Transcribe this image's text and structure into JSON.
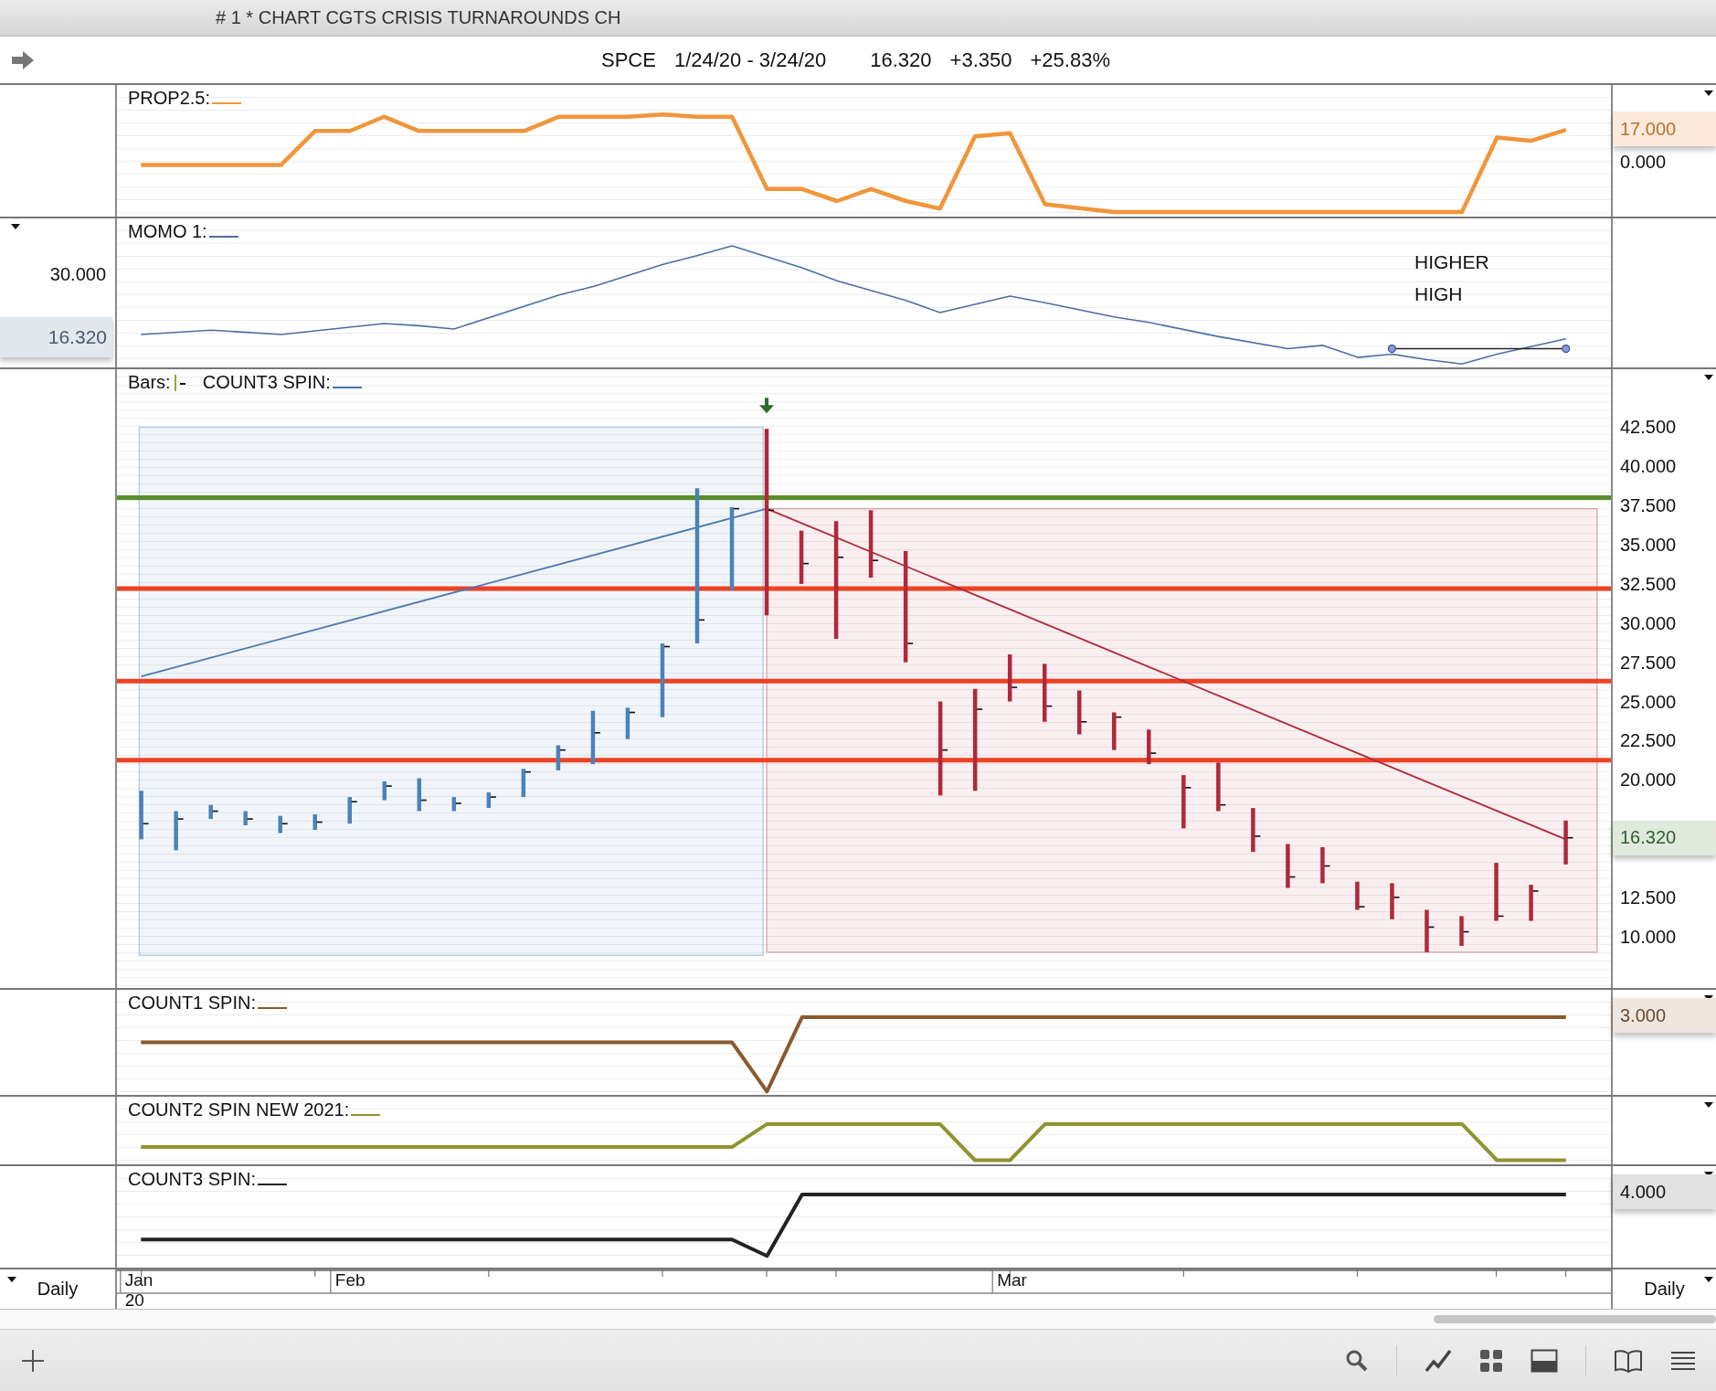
{
  "window": {
    "title": "# 1 * CHART CGTS CRISIS TURNAROUNDS CH"
  },
  "quote": {
    "symbol": "SPCE",
    "range": "1/24/20 - 3/24/20",
    "last": "16.320",
    "change": "+3.350",
    "percent": "+25.83%"
  },
  "panels": [
    {
      "kind": "prop",
      "title": "PROP2.5:",
      "color": "#f0963a",
      "badge": "17.000",
      "right_ticks": [
        "0.000"
      ]
    },
    {
      "kind": "momo",
      "title": "MOMO 1:",
      "color": "#4a6fa5",
      "left_ticks": [
        "30.000"
      ],
      "left_badge": "16.320",
      "note": "HIGHER HIGH"
    },
    {
      "kind": "price",
      "bars_label": "Bars:",
      "title": "COUNT3 SPIN:",
      "color": "#4a6fa5",
      "badge": "16.320",
      "right_ticks": [
        "42.500",
        "40.000",
        "37.500",
        "35.000",
        "32.500",
        "30.000",
        "27.500",
        "25.000",
        "22.500",
        "20.000",
        "12.500",
        "10.000"
      ]
    },
    {
      "kind": "count1",
      "title": "COUNT1 SPIN:",
      "color": "#8b5a2b",
      "badge": "3.000"
    },
    {
      "kind": "count2",
      "title": "COUNT2 SPIN NEW 2021:",
      "color": "#8f9430"
    },
    {
      "kind": "count3",
      "title": "COUNT3 SPIN:",
      "color": "#222222",
      "badge": "4.000"
    }
  ],
  "date_axis": {
    "left_label": "Daily",
    "right_label": "Daily",
    "months": [
      "Jan",
      "Feb",
      "Mar"
    ],
    "year": "20"
  }
}
